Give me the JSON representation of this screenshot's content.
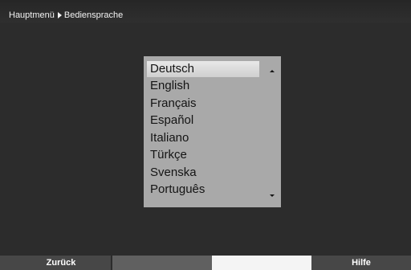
{
  "header": {
    "breadcrumb_parent": "Hauptmenü",
    "breadcrumb_current": "Bediensprache"
  },
  "language_list": {
    "selected": "Deutsch",
    "items": [
      "Deutsch",
      "English",
      "Français",
      "Español",
      "Italiano",
      "Türkçe",
      "Svenska",
      "Português"
    ]
  },
  "footer": {
    "red_label": "Zurück",
    "green_label": "",
    "yellow_label": "",
    "blue_label": "Hilfe"
  },
  "colors": {
    "screen_background": "#2c2c2c",
    "panel_background": "#a9a9a9",
    "selection_highlight": "#e0e0e0",
    "text_light": "#f2f2f2",
    "text_dark": "#141414"
  },
  "icons": {
    "breadcrumb_separator": "triangle-right-icon",
    "scroll_up": "arrow-up-icon",
    "scroll_down": "arrow-down-icon"
  }
}
